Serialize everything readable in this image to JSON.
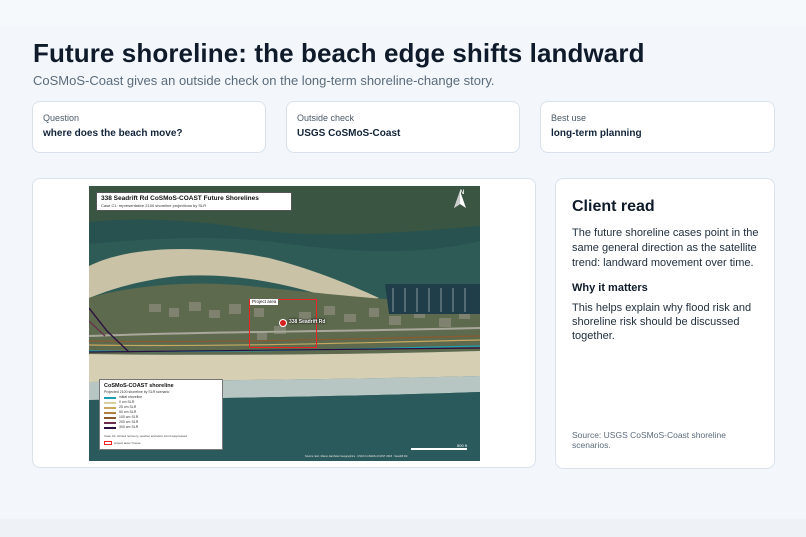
{
  "header": {
    "title": "Future shoreline: the beach edge shifts landward",
    "subtitle": "CoSMoS-Coast gives an outside check on the long-term shoreline-change story."
  },
  "cards": [
    {
      "label": "Question",
      "value": "where does the beach move?"
    },
    {
      "label": "Outside check",
      "value": "USGS CoSMoS-Coast"
    },
    {
      "label": "Best use",
      "value": "long-term planning"
    }
  ],
  "map": {
    "title": "338 Seadrift Rd CoSMoS-COAST Future Shorelines",
    "subtitle": "Case C1: representative 2100 shoreline projections by SLR",
    "north_label": "N",
    "project_area_label": "Project area",
    "site_label": "338 Seadrift Rd",
    "scale_label": "500 ft",
    "credit": "Source: Esri, Maxar, Earthstar Geographics · USGS CoSMoS-COAST 2018 · Seadrift Rd",
    "legend": {
      "title": "CoSMoS-COAST shoreline",
      "subtitle": "Projected 2100 shoreline by SLR scenario",
      "items": [
        {
          "label": "initial shoreline",
          "color": "#1e9fb0"
        },
        {
          "label": "0 cm SLR",
          "color": "#d8d0a0"
        },
        {
          "label": "25 cm SLR",
          "color": "#c8a860"
        },
        {
          "label": "50 cm SLR",
          "color": "#b28040"
        },
        {
          "label": "100 cm SLR",
          "color": "#8a5a30"
        },
        {
          "label": "200 cm SLR",
          "color": "#6a2f4f"
        },
        {
          "label": "300 cm SLR",
          "color": "#2a1040"
        }
      ],
      "note": "Case C1: limited recovery, positive accretion trend suppressed",
      "project_area": "project area / house"
    }
  },
  "side": {
    "heading": "Client read",
    "body": "The future shoreline cases point in the same general direction as the satellite trend: landward movement over time.",
    "subheading": "Why it matters",
    "body2": "This helps explain why flood risk and shoreline risk should be discussed together.",
    "source": "Source: USGS CoSMoS-Coast shoreline scenarios."
  }
}
